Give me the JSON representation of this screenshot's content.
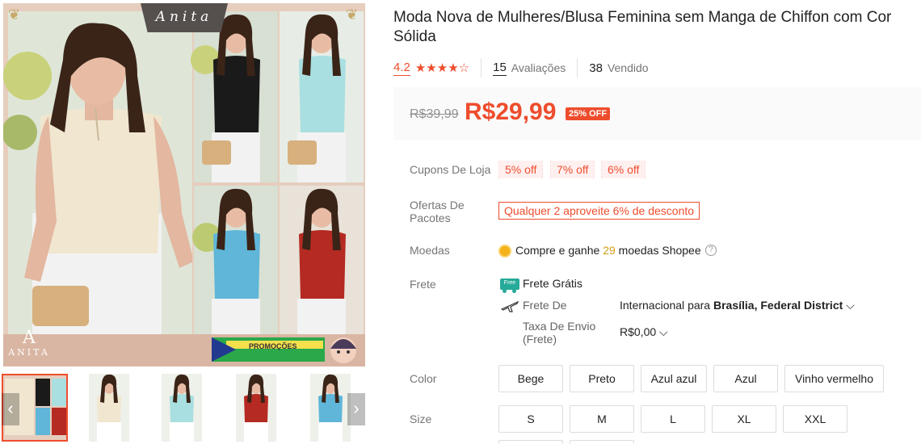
{
  "gallery": {
    "brand": "Anita",
    "logo_letter": "A",
    "logo_word": "ANITA",
    "promo": "PROMOÇÕES",
    "prev": "‹",
    "next": "›"
  },
  "product": {
    "title": "Moda Nova de Mulheres/Blusa Feminina sem Manga de Chiffon com Cor Sólida",
    "rating": "4.2",
    "stars": "★★★★☆",
    "reviews_count": "15",
    "reviews_label": "Avaliações",
    "sold_count": "38",
    "sold_label": "Vendido",
    "old_price": "R$39,99",
    "price": "R$29,99",
    "discount": "25% OFF"
  },
  "coupons": {
    "label": "Cupons De Loja",
    "items": [
      "5% off",
      "7% off",
      "6% off"
    ]
  },
  "deals": {
    "label": "Ofertas De Pacotes",
    "label_line1": "Ofertas De",
    "label_line2": "Pacotes",
    "offer": "Qualquer 2 aproveite 6% de desconto"
  },
  "coins": {
    "label": "Moedas",
    "text_before": "Compre e ganhe",
    "amount": "29",
    "text_after": "moedas Shopee",
    "help": "?"
  },
  "shipping": {
    "label": "Frete",
    "free_badge": "Free",
    "free_text": "Frete Grátis",
    "from_label": "Frete De",
    "from_value": "Internacional",
    "to_word": "para",
    "destination": "Brasília, Federal District",
    "fee_label_line1": "Taxa De Envio",
    "fee_label_line2": "(Frete)",
    "fee_value": "R$0,00"
  },
  "color": {
    "label": "Color",
    "options": [
      "Bege",
      "Preto",
      "Azul azul",
      "Azul",
      "Vinho vermelho"
    ]
  },
  "size": {
    "label": "Size",
    "options": [
      "S",
      "M",
      "L",
      "XL",
      "XXL"
    ]
  },
  "colors": {
    "accent": "#ee4d2d",
    "beige": "#f1e6cf",
    "black": "#1a1a1a",
    "light_blue": "#a9dfe0",
    "blue": "#5fb6d8",
    "wine": "#b52a22"
  }
}
